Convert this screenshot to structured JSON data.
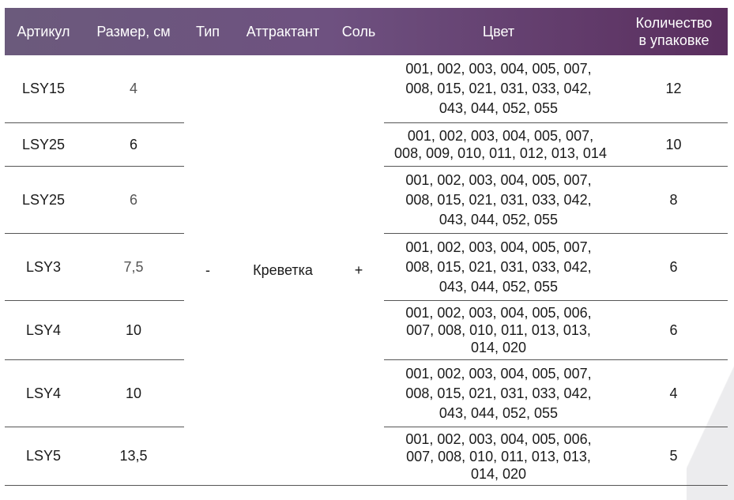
{
  "header": {
    "article": "Артикул",
    "size": "Размер, см",
    "type": "Тип",
    "attractant": "Аттрактант",
    "salt": "Соль",
    "color": "Цвет",
    "qty_line1": "Количество",
    "qty_line2": "в упаковке"
  },
  "shared": {
    "type": "-",
    "attractant": "Креветка",
    "salt": "+"
  },
  "rows": [
    {
      "article": "LSY15",
      "size": "4",
      "color": [
        "001, 002, 003, 004, 005, 007,",
        "008, 015, 021, 031, 033, 042,",
        "043, 044, 052, 055"
      ],
      "qty": "12"
    },
    {
      "article": "LSY25",
      "size": "6",
      "color": [
        "001, 002, 003, 004, 005, 007,",
        "008, 009, 010, 011, 012, 013, 014"
      ],
      "qty": "10"
    },
    {
      "article": "LSY25",
      "size": "6",
      "color": [
        "001, 002, 003, 004, 005, 007,",
        "008, 015, 021, 031, 033, 042,",
        "043, 044, 052, 055"
      ],
      "qty": "8"
    },
    {
      "article": "LSY3",
      "size": "7,5",
      "color": [
        "001, 002, 003, 004, 005, 007,",
        "008, 015, 021, 031, 033, 042,",
        "043, 044, 052, 055"
      ],
      "qty": "6"
    },
    {
      "article": "LSY4",
      "size": "10",
      "color": [
        "001, 002, 003, 004, 005, 006,",
        "007, 008, 010, 011, 013, 013,",
        "014, 020"
      ],
      "qty": "6"
    },
    {
      "article": "LSY4",
      "size": "10",
      "color": [
        "001, 002, 003, 004, 005, 007,",
        "008, 015, 021, 031, 033, 042,",
        "043, 044, 052, 055"
      ],
      "qty": "4"
    },
    {
      "article": "LSY5",
      "size": "13,5",
      "color": [
        "001, 002, 003, 004, 005, 006,",
        "007, 008, 010, 011, 013, 013,",
        "014, 020"
      ],
      "qty": "5"
    }
  ]
}
